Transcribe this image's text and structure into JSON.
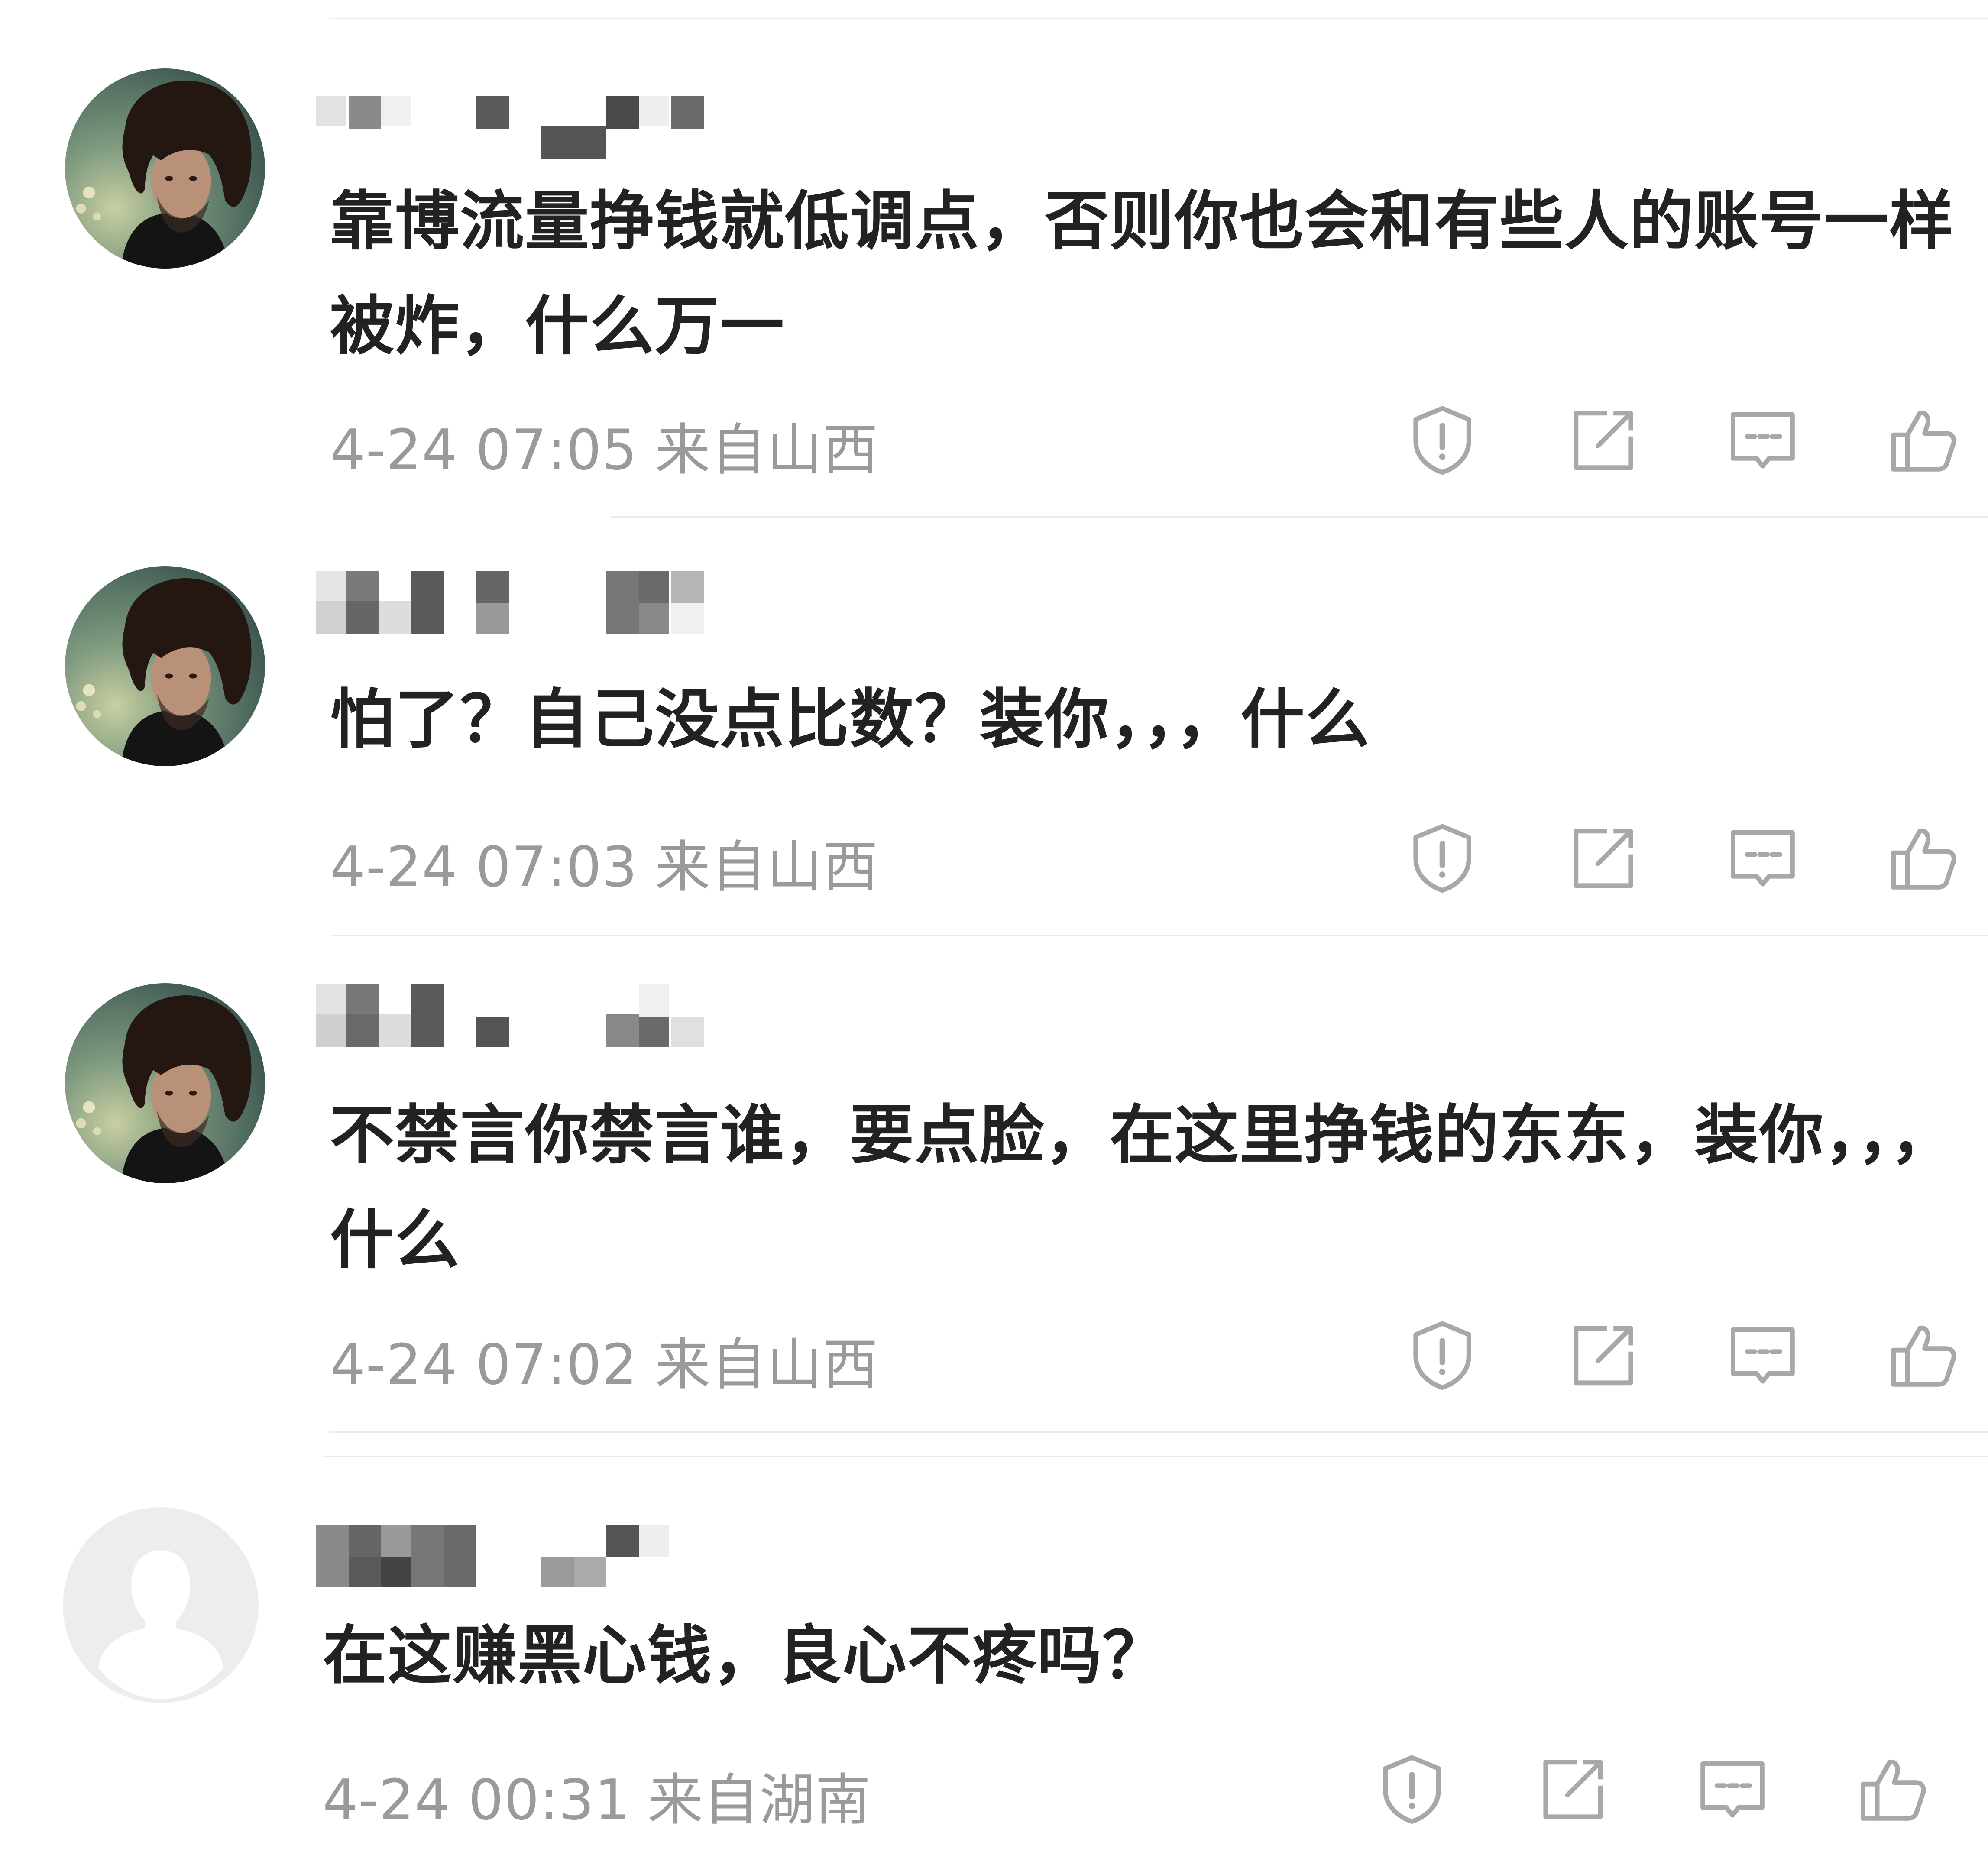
{
  "comments": [
    {
      "text": "靠博流量挣钱就低调点，否则你也会和有些人的账号一样被炸，什么万一",
      "date": "4-24 07:05",
      "location": "来自山西",
      "avatar": "photo-avatar"
    },
    {
      "text": "怕了？自己没点比数？装你，，，什么",
      "date": "4-24 07:03",
      "location": "来自山西",
      "avatar": "photo-avatar"
    },
    {
      "text": "不禁言你禁言谁，要点脸，在这里挣钱的东东，装你，，，什么",
      "date": "4-24 07:02",
      "location": "来自山西",
      "avatar": "photo-avatar"
    },
    {
      "text": "在这赚黑心钱，良心不疼吗？",
      "date": "4-24 00:31",
      "location": "来自湖南",
      "avatar": "default-avatar"
    }
  ],
  "icons": [
    "report-icon",
    "repost-icon",
    "reply-icon",
    "like-icon"
  ],
  "colors": {
    "text": "#222222",
    "meta": "#9a9a9a",
    "icon": "#a8a8a8",
    "divider": "#ececec"
  }
}
